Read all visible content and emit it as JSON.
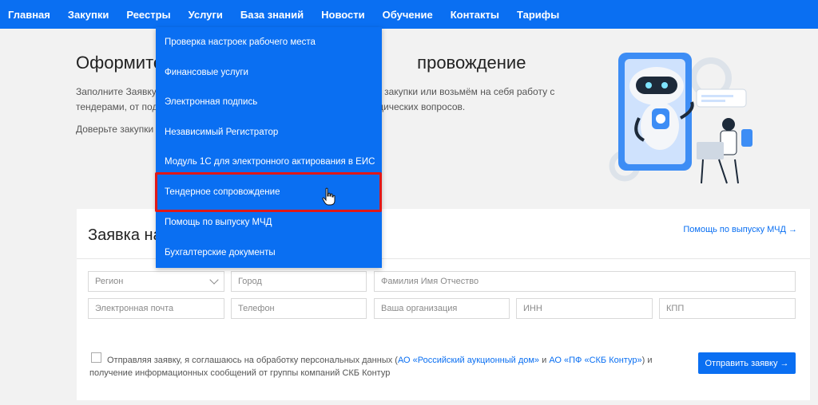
{
  "nav": {
    "items": [
      "Главная",
      "Закупки",
      "Реестры",
      "Услуги",
      "База знаний",
      "Новости",
      "Обучение",
      "Контакты",
      "Тарифы"
    ]
  },
  "hero": {
    "title_left": "Оформите",
    "title_right": "провождение",
    "desc_left_1": "Заполните Заявку",
    "desc_right_1": "те закупки или возьмём на себя работу с",
    "desc_left_2": "тендерами, от подб",
    "desc_right_2": "идических вопросов.",
    "trust": "Доверьте закупки"
  },
  "dropdown": {
    "items": [
      "Проверка настроек рабочего места",
      "Финансовые услуги",
      "Электронная подпись",
      "Независимый Регистратор",
      "Модуль 1С для электронного актирования в ЕИС",
      "Тендерное сопровождение",
      "Помощь по выпуску МЧД",
      "Бухгалтерские документы"
    ]
  },
  "form": {
    "title": "Заявка на",
    "mcd_link": "Помощь по выпуску МЧД →",
    "fields": {
      "region": "Регион",
      "city": "Город",
      "fio": "Фамилия Имя Отчество",
      "email": "Электронная почта",
      "phone": "Телефон",
      "org": "Ваша организация",
      "inn": "ИНН",
      "kpp": "КПП"
    },
    "consent_1": "Отправляя заявку, я соглашаюсь на обработку персональных данных (",
    "consent_link_1": "АО «Российский аукционный дом»",
    "consent_2": " и ",
    "consent_link_2": "АО «ПФ «СКБ Контур»",
    "consent_3": ") и получение информационных сообщений от группы компаний СКБ Контур",
    "submit": "Отправить заявку →"
  },
  "colors": {
    "accent": "#0a6ff2",
    "highlight": "#e01818"
  }
}
